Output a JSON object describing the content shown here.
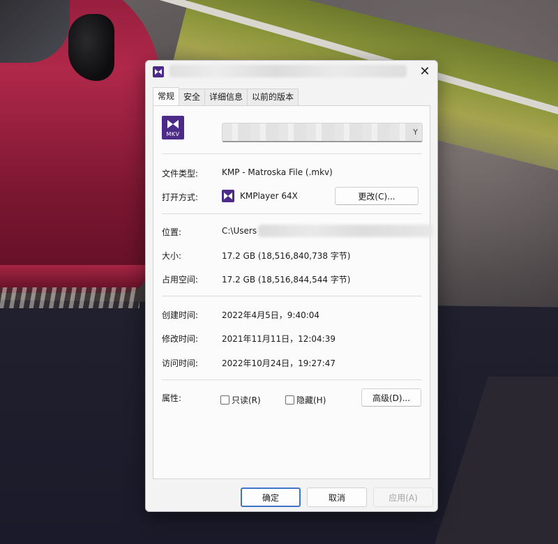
{
  "dialog": {
    "title": "",
    "close_glyph": "✕",
    "app_icon": "kmplayer-icon"
  },
  "tabs": [
    {
      "label": "常规",
      "active": true
    },
    {
      "label": "安全"
    },
    {
      "label": "详细信息"
    },
    {
      "label": "以前的版本"
    }
  ],
  "general": {
    "file_icon_text": "MKV",
    "file_name_visible": "Y",
    "file_type_label": "文件类型:",
    "file_type_value": "KMP - Matroska File (.mkv)",
    "open_with_label": "打开方式:",
    "open_with_value": "KMPlayer 64X",
    "change_button": "更改(C)...",
    "location_label": "位置:",
    "location_value": "C:\\Users",
    "size_label": "大小:",
    "size_value": "17.2 GB (18,516,840,738 字节)",
    "disk_size_label": "占用空间:",
    "disk_size_value": "17.2 GB (18,516,844,544 字节)",
    "created_label": "创建时间:",
    "created_value": "2022年4月5日，9:40:04",
    "modified_label": "修改时间:",
    "modified_value": "2021年11月11日，12:04:39",
    "accessed_label": "访问时间:",
    "accessed_value": "2022年10月24日，19:27:47",
    "attributes_label": "属性:",
    "readonly_label": "只读(R)",
    "hidden_label": "隐藏(H)",
    "advanced_button": "高级(D)..."
  },
  "footer": {
    "ok": "确定",
    "cancel": "取消",
    "apply": "应用(A)"
  },
  "colors": {
    "kmplayer_purple": "#4b2a88",
    "focus_blue": "#3f74c8"
  }
}
